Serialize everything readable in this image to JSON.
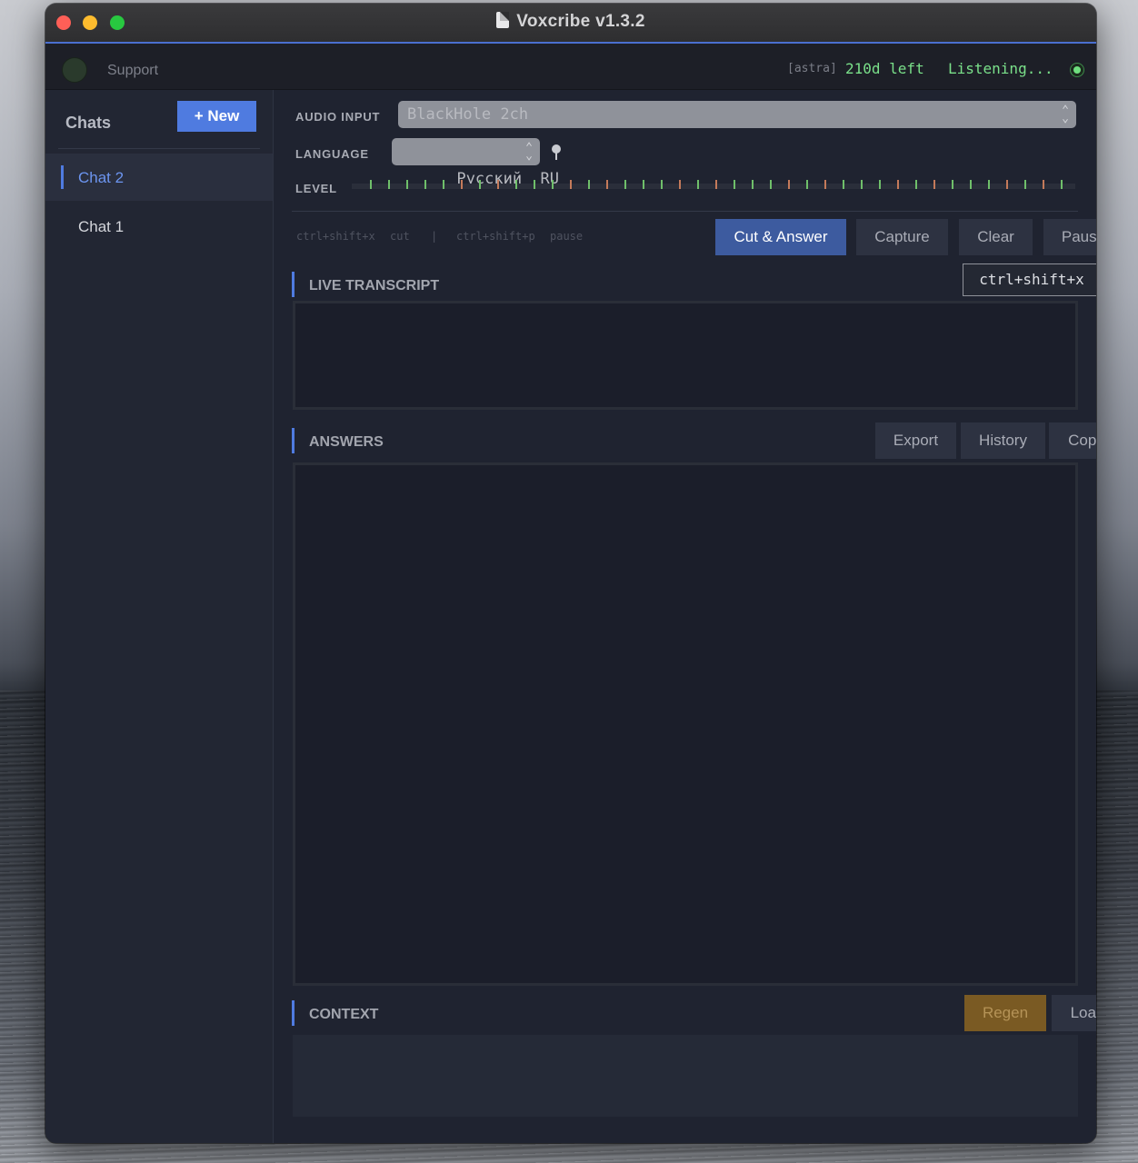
{
  "window": {
    "title": "Voxcribe v1.3.2"
  },
  "topbar": {
    "support_label": "Support",
    "user_tag": "[astra]",
    "days_left": "210d left",
    "status": "Listening..."
  },
  "sidebar": {
    "title": "Chats",
    "new_button": "+ New",
    "items": [
      {
        "label": "Chat 2",
        "active": true
      },
      {
        "label": "Chat 1",
        "active": false
      }
    ]
  },
  "audio_input": {
    "label": "AUDIO INPUT",
    "value": "BlackHole 2ch"
  },
  "language": {
    "label": "LANGUAGE",
    "value": "Русский  RU"
  },
  "level": {
    "label": "LEVEL"
  },
  "hints": {
    "cut_keys": "ctrl+shift+x",
    "cut_label": "cut",
    "separator": "|",
    "pause_keys": "ctrl+shift+p",
    "pause_label": "pause"
  },
  "actions": {
    "cut_answer": "Cut & Answer",
    "capture": "Capture",
    "clear": "Clear",
    "pause": "Pause",
    "tooltip": "ctrl+shift+x"
  },
  "live_transcript": {
    "title": "LIVE TRANSCRIPT"
  },
  "answers": {
    "title": "ANSWERS",
    "export": "Export",
    "history": "History",
    "copy": "Copy"
  },
  "context": {
    "title": "CONTEXT",
    "regen": "Regen",
    "load": "Load"
  },
  "colors": {
    "accent": "#4f7be0",
    "status_green": "#7ae08a",
    "regen_orange": "#7a5a23"
  }
}
